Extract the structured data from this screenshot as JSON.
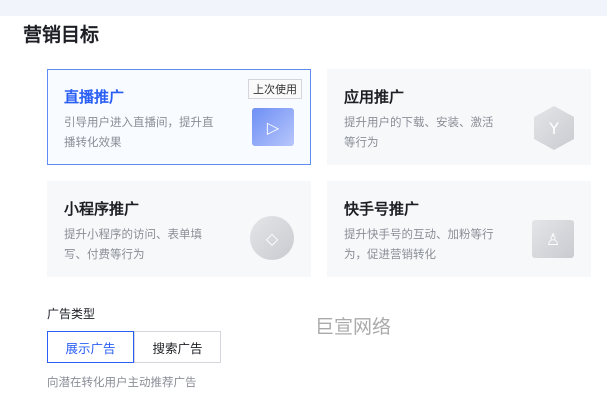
{
  "title": "营销目标",
  "cards": [
    {
      "title": "直播推广",
      "desc": "引导用户进入直播间，提升直播转化效果",
      "badge": "上次使用",
      "icon": "▷"
    },
    {
      "title": "应用推广",
      "desc": "提升用户的下载、安装、激活等行为",
      "icon": "Y"
    },
    {
      "title": "小程序推广",
      "desc": "提升小程序的访问、表单填写、付费等行为",
      "icon": "◇"
    },
    {
      "title": "快手号推广",
      "desc": "提升快手号的互动、加粉等行为，促进营销转化",
      "icon": "♙"
    }
  ],
  "ad_type": {
    "label": "广告类型",
    "options": [
      "展示广告",
      "搜索广告"
    ],
    "hint": "向潜在转化用户主动推荐广告"
  },
  "watermark": "巨宣网络"
}
